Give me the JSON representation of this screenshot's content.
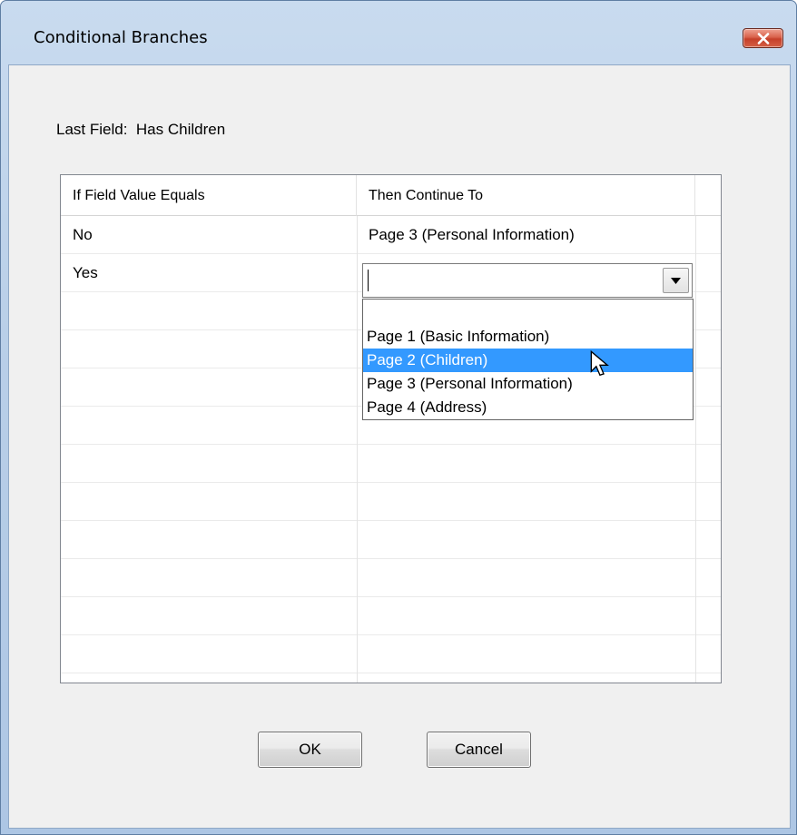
{
  "window": {
    "title": "Conditional Branches"
  },
  "last_field": {
    "label": "Last Field:",
    "value": "Has Children"
  },
  "grid": {
    "columns": [
      "If Field Value Equals",
      "Then Continue To"
    ],
    "rows": [
      {
        "value": "No",
        "target": "Page 3 (Personal Information)"
      },
      {
        "value": "Yes",
        "target": ""
      }
    ]
  },
  "combo": {
    "current_value": "",
    "options": [
      "",
      "Page 1 (Basic Information)",
      "Page 2 (Children)",
      "Page 3 (Personal Information)",
      "Page 4 (Address)"
    ],
    "highlighted_option": "Page 2 (Children)"
  },
  "buttons": {
    "ok": "OK",
    "cancel": "Cancel"
  },
  "colors": {
    "selection": "#3399ff",
    "close_button": "#c5402a"
  },
  "icons": [
    "close-icon",
    "dropdown-arrow-icon",
    "mouse-cursor-icon"
  ]
}
